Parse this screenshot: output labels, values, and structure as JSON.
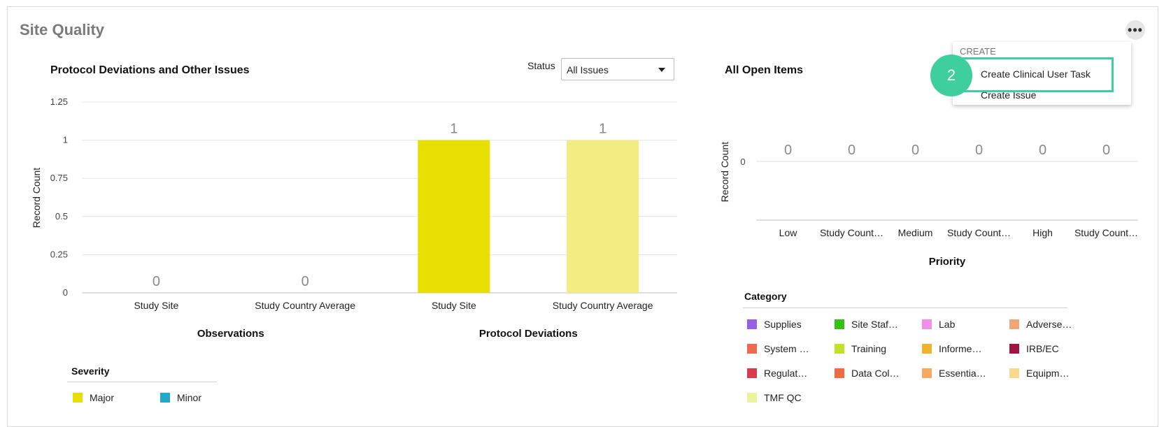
{
  "page": {
    "title": "Site Quality",
    "more_icon": "ellipsis-icon"
  },
  "status_filter": {
    "label": "Status",
    "value": "All Issues"
  },
  "chart_left": {
    "title": "Protocol Deviations and Other Issues",
    "data_labels": [
      "0",
      "0",
      "1",
      "1"
    ],
    "legend": {
      "title": "Severity",
      "items": [
        {
          "label": "Major",
          "color": "#e8de00"
        },
        {
          "label": "Minor",
          "color": "#21a9c9"
        }
      ]
    }
  },
  "chart_right": {
    "title": "All Open Items",
    "data_labels": [
      "0",
      "0",
      "0",
      "0",
      "0",
      "0"
    ],
    "legend": {
      "title": "Category",
      "items": [
        {
          "label": "Supplies",
          "color": "#9b5de5"
        },
        {
          "label": "Site Staf…",
          "color": "#34c217"
        },
        {
          "label": "Lab",
          "color": "#f08fe8"
        },
        {
          "label": "Adverse…",
          "color": "#f4a574"
        },
        {
          "label": "System …",
          "color": "#f0694e"
        },
        {
          "label": "Training",
          "color": "#c3e02b"
        },
        {
          "label": "Informe…",
          "color": "#f0b330"
        },
        {
          "label": "IRB/EC",
          "color": "#a3133f"
        },
        {
          "label": "Regulat…",
          "color": "#d83a4e"
        },
        {
          "label": "Data Col…",
          "color": "#f06a44"
        },
        {
          "label": "Essentia…",
          "color": "#f5a961"
        },
        {
          "label": "Equipm…",
          "color": "#f8d98a"
        },
        {
          "label": "TMF QC",
          "color": "#eaf39a"
        }
      ]
    }
  },
  "chart_data": [
    {
      "type": "bar",
      "title": "Protocol Deviations and Other Issues",
      "ylabel": "Record Count",
      "ylim": [
        0,
        1.25
      ],
      "yticks": [
        "0",
        "0.25",
        "0.5",
        "0.75",
        "1",
        "1.25"
      ],
      "yvalues": [
        0,
        0.25,
        0.5,
        0.75,
        1,
        1.25
      ],
      "categories": [
        "Study Site",
        "Study Country Average",
        "Study Site",
        "Study Country Average"
      ],
      "groups": [
        "Observations",
        "Protocol Deviations"
      ],
      "values": [
        0,
        0,
        1,
        1
      ],
      "colors": [
        "#e8de00",
        "#e8de00",
        "#e8de00",
        "#f3ec83"
      ],
      "legend": [
        "Major",
        "Minor"
      ],
      "grid": true
    },
    {
      "type": "bar",
      "title": "All Open Items",
      "ylabel": "Record Count",
      "xlabel": "Priority",
      "yticks": [
        "0"
      ],
      "categories": [
        "Low",
        "Study Count…",
        "Medium",
        "Study Count…",
        "High",
        "Study Count…"
      ],
      "values": [
        0,
        0,
        0,
        0,
        0,
        0
      ],
      "grid": true
    }
  ],
  "menu": {
    "header": "CREATE",
    "items": [
      "Create Clinical User Task",
      "Create Issue"
    ]
  },
  "step_badge": "2",
  "colors": {
    "accent": "#3fcf9f"
  }
}
